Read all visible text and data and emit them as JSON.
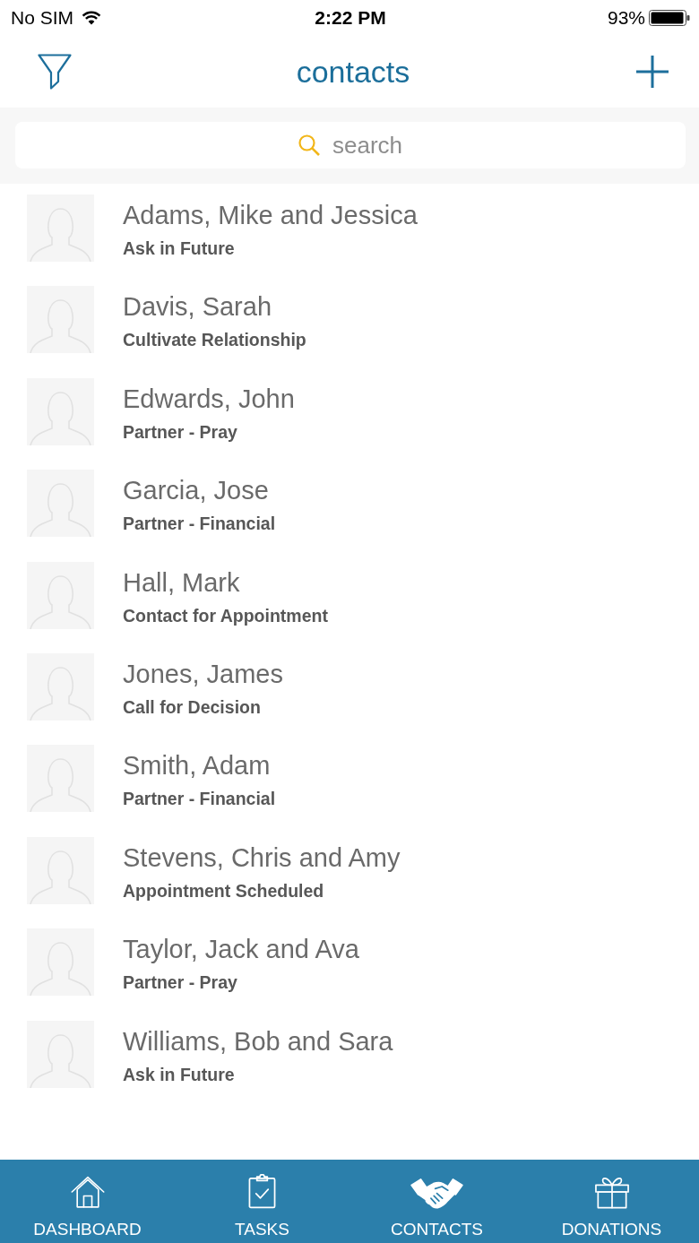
{
  "status_bar": {
    "carrier": "No SIM",
    "time": "2:22 PM",
    "battery": "93%"
  },
  "header": {
    "title": "contacts"
  },
  "search": {
    "placeholder": "search"
  },
  "contacts": [
    {
      "name": "Adams, Mike and Jessica",
      "status": "Ask in Future"
    },
    {
      "name": "Davis, Sarah",
      "status": "Cultivate Relationship"
    },
    {
      "name": "Edwards, John",
      "status": "Partner - Pray"
    },
    {
      "name": "Garcia, Jose",
      "status": "Partner - Financial"
    },
    {
      "name": "Hall, Mark",
      "status": "Contact for Appointment"
    },
    {
      "name": "Jones, James",
      "status": "Call for Decision"
    },
    {
      "name": "Smith, Adam",
      "status": "Partner - Financial"
    },
    {
      "name": "Stevens, Chris and Amy",
      "status": "Appointment Scheduled"
    },
    {
      "name": "Taylor, Jack and Ava",
      "status": "Partner - Pray"
    },
    {
      "name": "Williams, Bob and Sara",
      "status": "Ask in Future"
    }
  ],
  "tab_bar": [
    {
      "label": "DASHBOARD",
      "kind": "house",
      "selected": false
    },
    {
      "label": "TASKS",
      "kind": "clipboard",
      "selected": false
    },
    {
      "label": "CONTACTS",
      "kind": "handshake",
      "selected": true
    },
    {
      "label": "DONATIONS",
      "kind": "gift",
      "selected": false
    }
  ]
}
